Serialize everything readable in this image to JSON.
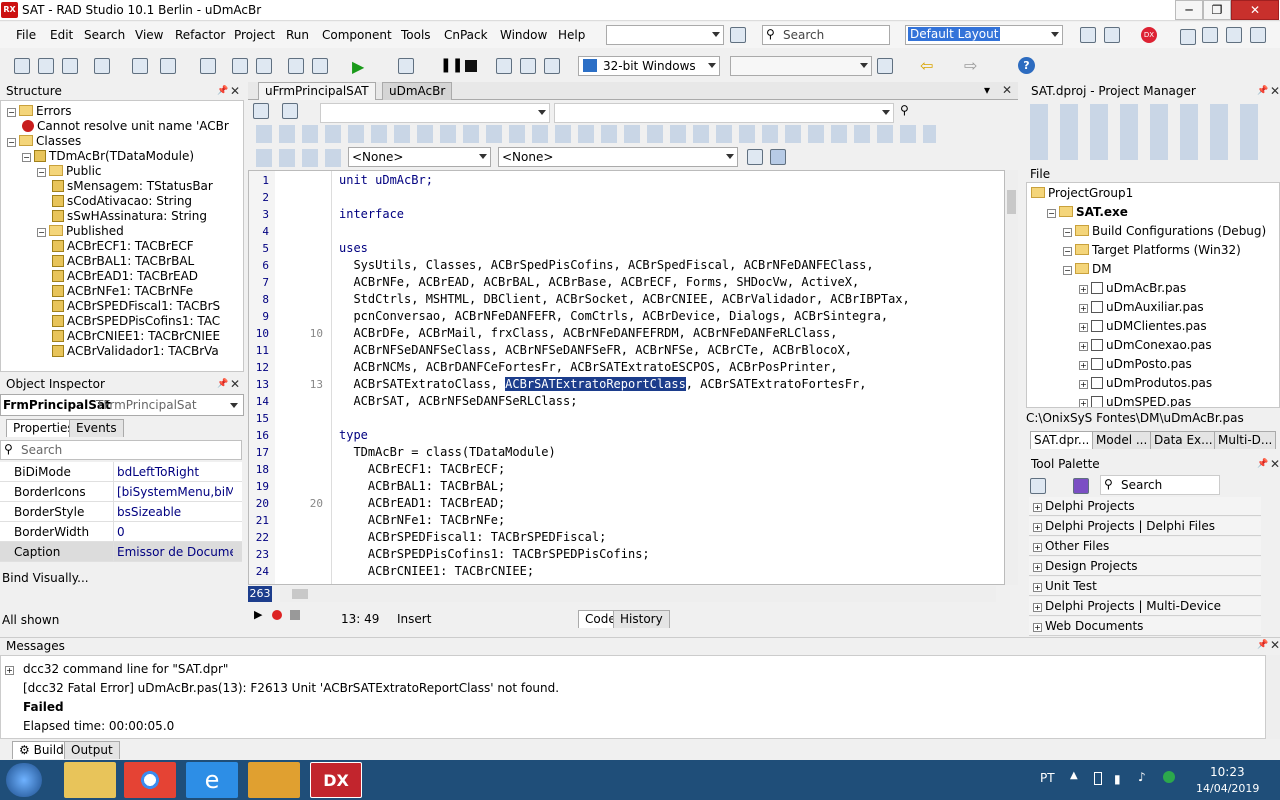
{
  "window": {
    "title": "SAT - RAD Studio 10.1 Berlin - uDmAcBr",
    "logo": "RX",
    "min": "─",
    "max": "❐",
    "close": "✕"
  },
  "menu": [
    "File",
    "Edit",
    "Search",
    "View",
    "Refactor",
    "Project",
    "Run",
    "Component",
    "Tools",
    "CnPack",
    "Window",
    "Help"
  ],
  "toolbar": {
    "search_placeholder": "Search",
    "layout": "Default Layout",
    "platform": "32-bit Windows"
  },
  "structure": {
    "title": "Structure",
    "items": [
      {
        "label": "Errors",
        "indent": 0,
        "kind": "folder"
      },
      {
        "label": "Cannot resolve unit name 'ACBr",
        "indent": 1,
        "kind": "error"
      },
      {
        "label": "Classes",
        "indent": 0,
        "kind": "folder"
      },
      {
        "label": "TDmAcBr(TDataModule)",
        "indent": 1,
        "kind": "class"
      },
      {
        "label": "Public",
        "indent": 2,
        "kind": "folder"
      },
      {
        "label": "sMensagem: TStatusBar",
        "indent": 3,
        "kind": "field"
      },
      {
        "label": "sCodAtivacao: String",
        "indent": 3,
        "kind": "field"
      },
      {
        "label": "sSwHAssinatura: String",
        "indent": 3,
        "kind": "field"
      },
      {
        "label": "Published",
        "indent": 2,
        "kind": "folder"
      },
      {
        "label": "ACBrECF1: TACBrECF",
        "indent": 3,
        "kind": "field"
      },
      {
        "label": "ACBrBAL1: TACBrBAL",
        "indent": 3,
        "kind": "field"
      },
      {
        "label": "ACBrEAD1: TACBrEAD",
        "indent": 3,
        "kind": "field"
      },
      {
        "label": "ACBrNFe1: TACBrNFe",
        "indent": 3,
        "kind": "field"
      },
      {
        "label": "ACBrSPEDFiscal1: TACBrS",
        "indent": 3,
        "kind": "field"
      },
      {
        "label": "ACBrSPEDPisCofins1: TAC",
        "indent": 3,
        "kind": "field"
      },
      {
        "label": "ACBrCNIEE1: TACBrCNIEE",
        "indent": 3,
        "kind": "field"
      },
      {
        "label": "ACBrValidador1: TACBrVa",
        "indent": 3,
        "kind": "field"
      }
    ]
  },
  "inspector": {
    "title": "Object Inspector",
    "object": "FrmPrincipalSat",
    "type": "TFrmPrincipalSat",
    "tabs": [
      "Properties",
      "Events"
    ],
    "search": "Search",
    "props": [
      {
        "k": "BiDiMode",
        "v": "bdLeftToRight"
      },
      {
        "k": "BorderIcons",
        "v": "[biSystemMenu,biMi"
      },
      {
        "k": "BorderStyle",
        "v": "bsSizeable"
      },
      {
        "k": "BorderWidth",
        "v": "0"
      },
      {
        "k": "Caption",
        "v": "Emissor de Documen"
      }
    ],
    "bind": "Bind Visually...",
    "shown": "All shown"
  },
  "editor": {
    "tabs": [
      "uFrmPrincipalSAT",
      "uDmAcBr"
    ],
    "combo1": "<None>",
    "combo2": "<None>",
    "lines": [
      {
        "n": "1",
        "t": "unit uDmAcBr;"
      },
      {
        "n": "2",
        "t": ""
      },
      {
        "n": "3",
        "t": "interface"
      },
      {
        "n": "4",
        "t": ""
      },
      {
        "n": "5",
        "t": "uses"
      },
      {
        "n": "6",
        "t": "  SysUtils, Classes, ACBrSpedPisCofins, ACBrSpedFiscal, ACBrNFeDANFEClass,"
      },
      {
        "n": "7",
        "t": "  ACBrNFe, ACBrEAD, ACBrBAL, ACBrBase, ACBrECF, Forms, SHDocVw, ActiveX,"
      },
      {
        "n": "8",
        "t": "  StdCtrls, MSHTML, DBClient, ACBrSocket, ACBrCNIEE, ACBrValidador, ACBrIBPTax,"
      },
      {
        "n": "9",
        "t": "  pcnConversao, ACBrNFeDANFEFR, ComCtrls, ACBrDevice, Dialogs, ACBrSintegra,"
      },
      {
        "n": "10",
        "t": "  ACBrDFe, ACBrMail, frxClass, ACBrNFeDANFEFRDM, ACBrNFeDANFeRLClass,"
      },
      {
        "n": "11",
        "t": "  ACBrNFSeDANFSeClass, ACBrNFSeDANFSeFR, ACBrNFSe, ACBrCTe, ACBrBlocoX,"
      },
      {
        "n": "12",
        "t": "  ACBrNCMs, ACBrDANFCeFortesFr, ACBrSATExtratoESCPOS, ACBrPosPrinter,"
      },
      {
        "n": "13",
        "t": "  ACBrSATExtratoClass, ",
        "sel": "ACBrSATExtratoReportClass",
        "after": ", ACBrSATExtratoFortesFr,"
      },
      {
        "n": "14",
        "t": "  ACBrSAT, ACBrNFSeDANFSeRLClass;"
      },
      {
        "n": "15",
        "t": ""
      },
      {
        "n": "16",
        "t": "type"
      },
      {
        "n": "17",
        "t": "  TDmAcBr = class(TDataModule)"
      },
      {
        "n": "18",
        "t": "    ACBrECF1: TACBrECF;"
      },
      {
        "n": "19",
        "t": "    ACBrBAL1: TACBrBAL;"
      },
      {
        "n": "20",
        "t": "    ACBrEAD1: TACBrEAD;"
      },
      {
        "n": "21",
        "t": "    ACBrNFe1: TACBrNFe;"
      },
      {
        "n": "22",
        "t": "    ACBrSPEDFiscal1: TACBrSPEDFiscal;"
      },
      {
        "n": "23",
        "t": "    ACBrSPEDPisCofins1: TACBrSPEDPisCofins;"
      },
      {
        "n": "24",
        "t": "    ACBrCNIEE1: TACBrCNIEE;"
      }
    ],
    "marks": [
      "10",
      "13",
      "20"
    ],
    "status_pos": "13: 49",
    "status_mode": "Insert",
    "bottom_tabs": [
      "Code",
      "History"
    ],
    "counter": "263"
  },
  "project": {
    "title": "SAT.dproj - Project Manager",
    "file_label": "File",
    "items": [
      {
        "label": "ProjectGroup1",
        "indent": 0,
        "bold": false
      },
      {
        "label": "SAT.exe",
        "indent": 1,
        "bold": true
      },
      {
        "label": "Build Configurations (Debug)",
        "indent": 2,
        "bold": false
      },
      {
        "label": "Target Platforms (Win32)",
        "indent": 2,
        "bold": false
      },
      {
        "label": "DM",
        "indent": 2,
        "bold": false
      },
      {
        "label": "uDmAcBr.pas",
        "indent": 3,
        "bold": false
      },
      {
        "label": "uDmAuxiliar.pas",
        "indent": 3,
        "bold": false
      },
      {
        "label": "uDMClientes.pas",
        "indent": 3,
        "bold": false
      },
      {
        "label": "uDmConexao.pas",
        "indent": 3,
        "bold": false
      },
      {
        "label": "uDmPosto.pas",
        "indent": 3,
        "bold": false
      },
      {
        "label": "uDmProdutos.pas",
        "indent": 3,
        "bold": false
      },
      {
        "label": "uDmSPED.pas",
        "indent": 3,
        "bold": false
      }
    ],
    "path": "C:\\OnixSyS Fontes\\DM\\uDmAcBr.pas",
    "tabs": [
      "SAT.dpr...",
      "Model ...",
      "Data Ex...",
      "Multi-D..."
    ]
  },
  "palette": {
    "title": "Tool Palette",
    "search": "Search",
    "items": [
      "Delphi Projects",
      "Delphi Projects | Delphi Files",
      "Other Files",
      "Design Projects",
      "Unit Test",
      "Delphi Projects | Multi-Device Projects",
      "Web Documents"
    ]
  },
  "messages": {
    "title": "Messages",
    "lines": [
      {
        "t": "dcc32 command line for \"SAT.dpr\"",
        "bold": false
      },
      {
        "t": "[dcc32 Fatal Error] uDmAcBr.pas(13): F2613 Unit 'ACBrSATExtratoReportClass' not found.",
        "bold": false
      },
      {
        "t": "Failed",
        "bold": true
      },
      {
        "t": "Elapsed time: 00:00:05.0",
        "bold": false
      }
    ],
    "tabs": [
      "Build",
      "Output"
    ]
  },
  "taskbar": {
    "lang": "PT",
    "time": "10:23",
    "date": "14/04/2019"
  }
}
